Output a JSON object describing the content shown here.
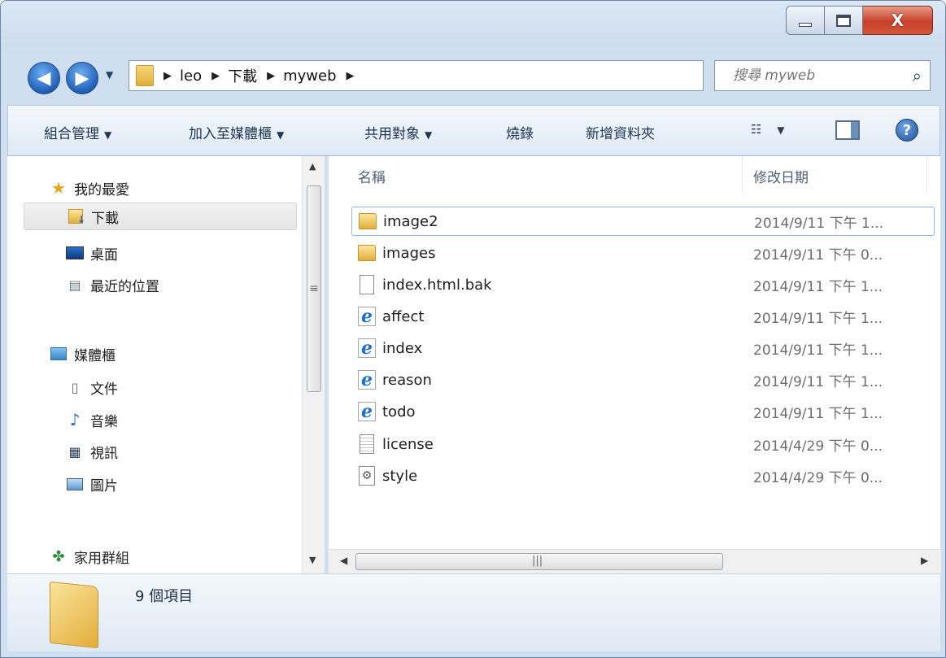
{
  "window": {
    "controls": {
      "minimize": "",
      "maximize": "",
      "close": "X"
    }
  },
  "address": {
    "crumbs": [
      "leo",
      "下載",
      "myweb"
    ]
  },
  "search": {
    "placeholder": "搜尋 myweb"
  },
  "toolbar": {
    "organize": "組合管理",
    "add_to_library": "加入至媒體櫃",
    "share": "共用對象",
    "burn": "燒錄",
    "new_folder": "新增資料夾"
  },
  "sidebar": {
    "favorites": {
      "label": "我的最愛",
      "items": [
        "下載",
        "桌面",
        "最近的位置"
      ],
      "selected": "下載"
    },
    "libraries": {
      "label": "媒體櫃",
      "items": [
        "文件",
        "音樂",
        "視訊",
        "圖片"
      ]
    },
    "homegroup": {
      "label": "家用群組"
    }
  },
  "columns": {
    "name": "名稱",
    "modified": "修改日期"
  },
  "files": [
    {
      "name": "image2",
      "date": "2014/9/11 下午 1...",
      "icon": "folder-icon"
    },
    {
      "name": "images",
      "date": "2014/9/11 下午 0...",
      "icon": "folder-icon"
    },
    {
      "name": "index.html.bak",
      "date": "2014/9/11 下午 1...",
      "icon": "blank-file-icon"
    },
    {
      "name": "affect",
      "date": "2014/9/11 下午 1...",
      "icon": "ie-document-icon"
    },
    {
      "name": "index",
      "date": "2014/9/11 下午 1...",
      "icon": "ie-document-icon"
    },
    {
      "name": "reason",
      "date": "2014/9/11 下午 1...",
      "icon": "ie-document-icon"
    },
    {
      "name": "todo",
      "date": "2014/9/11 下午 1...",
      "icon": "ie-document-icon"
    },
    {
      "name": "license",
      "date": "2014/4/29 下午 0...",
      "icon": "text-file-icon"
    },
    {
      "name": "style",
      "date": "2014/4/29 下午 0...",
      "icon": "css-file-icon"
    }
  ],
  "status": {
    "item_count": "9 個項目"
  },
  "colors": {
    "accent": "#1f5fb8",
    "close": "#c8402a",
    "folder": "#e2ae3d"
  }
}
